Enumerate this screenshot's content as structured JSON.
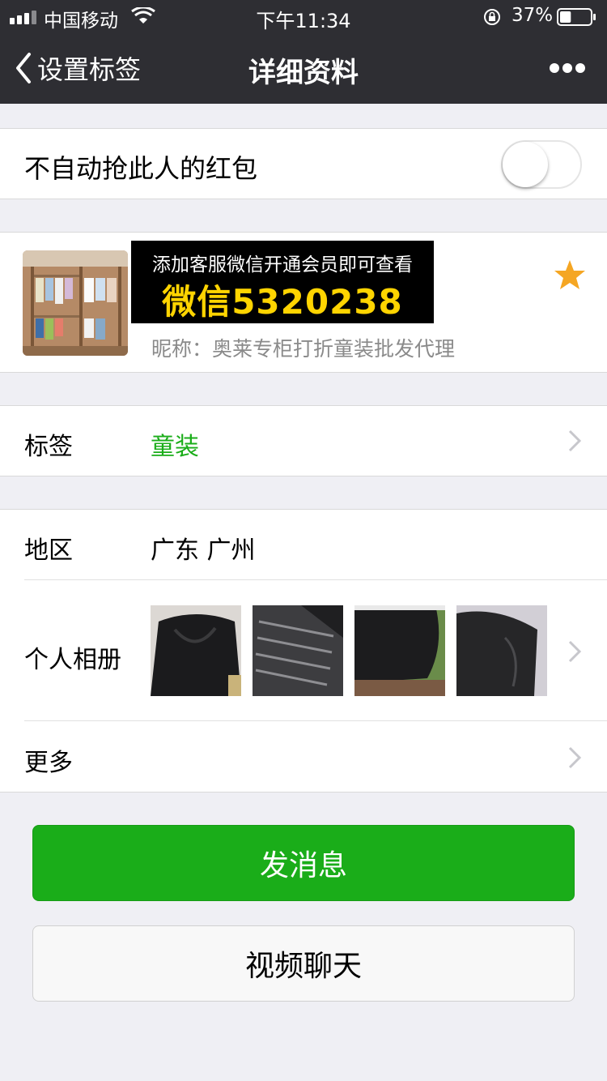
{
  "status_bar": {
    "carrier": "中国移动",
    "time": "下午11:34",
    "battery_percent_text": "37%",
    "battery_level": 0.37
  },
  "nav": {
    "back_label": "设置标签",
    "title": "详细资料",
    "more_icon": "more-icon"
  },
  "red_packet": {
    "label": "不自动抢此人的红包",
    "toggle_on": false
  },
  "profile": {
    "promo_line1": "添加客服微信开通会员即可查看",
    "promo_line2": "微信5320238",
    "nickname": "昵称：奥莱专柜打折童装批发代理",
    "starred": true,
    "colors": {
      "promo_text": "#ffd400",
      "star": "#f5a623"
    }
  },
  "tags": {
    "label": "标签",
    "value": "童装",
    "value_color": "#1aad19"
  },
  "info": {
    "region_label": "地区",
    "region_value": "广东 广州",
    "album_label": "个人相册",
    "album_photos": [
      "jacket-photo-1",
      "jacket-photo-2",
      "jacket-photo-3",
      "jacket-photo-4"
    ],
    "more_label": "更多"
  },
  "actions": {
    "send_message": "发消息",
    "video_chat": "视频聊天",
    "primary_color": "#1aad19"
  }
}
